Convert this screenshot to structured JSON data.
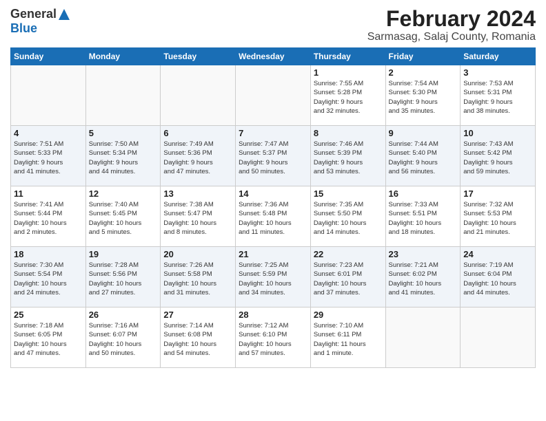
{
  "logo": {
    "general": "General",
    "blue": "Blue"
  },
  "title": "February 2024",
  "location": "Sarmasag, Salaj County, Romania",
  "days_of_week": [
    "Sunday",
    "Monday",
    "Tuesday",
    "Wednesday",
    "Thursday",
    "Friday",
    "Saturday"
  ],
  "weeks": [
    {
      "bg": "odd",
      "days": [
        {
          "num": "",
          "info": ""
        },
        {
          "num": "",
          "info": ""
        },
        {
          "num": "",
          "info": ""
        },
        {
          "num": "",
          "info": ""
        },
        {
          "num": "1",
          "info": "Sunrise: 7:55 AM\nSunset: 5:28 PM\nDaylight: 9 hours\nand 32 minutes."
        },
        {
          "num": "2",
          "info": "Sunrise: 7:54 AM\nSunset: 5:30 PM\nDaylight: 9 hours\nand 35 minutes."
        },
        {
          "num": "3",
          "info": "Sunrise: 7:53 AM\nSunset: 5:31 PM\nDaylight: 9 hours\nand 38 minutes."
        }
      ]
    },
    {
      "bg": "even",
      "days": [
        {
          "num": "4",
          "info": "Sunrise: 7:51 AM\nSunset: 5:33 PM\nDaylight: 9 hours\nand 41 minutes."
        },
        {
          "num": "5",
          "info": "Sunrise: 7:50 AM\nSunset: 5:34 PM\nDaylight: 9 hours\nand 44 minutes."
        },
        {
          "num": "6",
          "info": "Sunrise: 7:49 AM\nSunset: 5:36 PM\nDaylight: 9 hours\nand 47 minutes."
        },
        {
          "num": "7",
          "info": "Sunrise: 7:47 AM\nSunset: 5:37 PM\nDaylight: 9 hours\nand 50 minutes."
        },
        {
          "num": "8",
          "info": "Sunrise: 7:46 AM\nSunset: 5:39 PM\nDaylight: 9 hours\nand 53 minutes."
        },
        {
          "num": "9",
          "info": "Sunrise: 7:44 AM\nSunset: 5:40 PM\nDaylight: 9 hours\nand 56 minutes."
        },
        {
          "num": "10",
          "info": "Sunrise: 7:43 AM\nSunset: 5:42 PM\nDaylight: 9 hours\nand 59 minutes."
        }
      ]
    },
    {
      "bg": "odd",
      "days": [
        {
          "num": "11",
          "info": "Sunrise: 7:41 AM\nSunset: 5:44 PM\nDaylight: 10 hours\nand 2 minutes."
        },
        {
          "num": "12",
          "info": "Sunrise: 7:40 AM\nSunset: 5:45 PM\nDaylight: 10 hours\nand 5 minutes."
        },
        {
          "num": "13",
          "info": "Sunrise: 7:38 AM\nSunset: 5:47 PM\nDaylight: 10 hours\nand 8 minutes."
        },
        {
          "num": "14",
          "info": "Sunrise: 7:36 AM\nSunset: 5:48 PM\nDaylight: 10 hours\nand 11 minutes."
        },
        {
          "num": "15",
          "info": "Sunrise: 7:35 AM\nSunset: 5:50 PM\nDaylight: 10 hours\nand 14 minutes."
        },
        {
          "num": "16",
          "info": "Sunrise: 7:33 AM\nSunset: 5:51 PM\nDaylight: 10 hours\nand 18 minutes."
        },
        {
          "num": "17",
          "info": "Sunrise: 7:32 AM\nSunset: 5:53 PM\nDaylight: 10 hours\nand 21 minutes."
        }
      ]
    },
    {
      "bg": "even",
      "days": [
        {
          "num": "18",
          "info": "Sunrise: 7:30 AM\nSunset: 5:54 PM\nDaylight: 10 hours\nand 24 minutes."
        },
        {
          "num": "19",
          "info": "Sunrise: 7:28 AM\nSunset: 5:56 PM\nDaylight: 10 hours\nand 27 minutes."
        },
        {
          "num": "20",
          "info": "Sunrise: 7:26 AM\nSunset: 5:58 PM\nDaylight: 10 hours\nand 31 minutes."
        },
        {
          "num": "21",
          "info": "Sunrise: 7:25 AM\nSunset: 5:59 PM\nDaylight: 10 hours\nand 34 minutes."
        },
        {
          "num": "22",
          "info": "Sunrise: 7:23 AM\nSunset: 6:01 PM\nDaylight: 10 hours\nand 37 minutes."
        },
        {
          "num": "23",
          "info": "Sunrise: 7:21 AM\nSunset: 6:02 PM\nDaylight: 10 hours\nand 41 minutes."
        },
        {
          "num": "24",
          "info": "Sunrise: 7:19 AM\nSunset: 6:04 PM\nDaylight: 10 hours\nand 44 minutes."
        }
      ]
    },
    {
      "bg": "odd",
      "days": [
        {
          "num": "25",
          "info": "Sunrise: 7:18 AM\nSunset: 6:05 PM\nDaylight: 10 hours\nand 47 minutes."
        },
        {
          "num": "26",
          "info": "Sunrise: 7:16 AM\nSunset: 6:07 PM\nDaylight: 10 hours\nand 50 minutes."
        },
        {
          "num": "27",
          "info": "Sunrise: 7:14 AM\nSunset: 6:08 PM\nDaylight: 10 hours\nand 54 minutes."
        },
        {
          "num": "28",
          "info": "Sunrise: 7:12 AM\nSunset: 6:10 PM\nDaylight: 10 hours\nand 57 minutes."
        },
        {
          "num": "29",
          "info": "Sunrise: 7:10 AM\nSunset: 6:11 PM\nDaylight: 11 hours\nand 1 minute."
        },
        {
          "num": "",
          "info": ""
        },
        {
          "num": "",
          "info": ""
        }
      ]
    }
  ]
}
